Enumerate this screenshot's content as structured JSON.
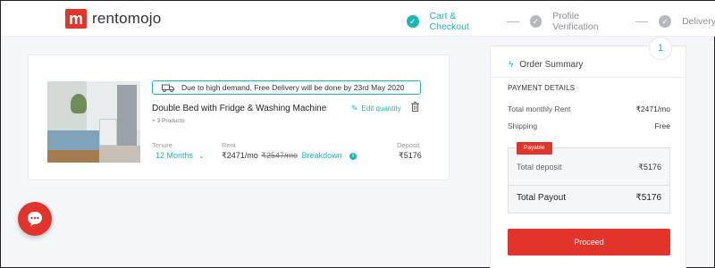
{
  "brand": {
    "logo_letter": "m",
    "name": "rentomojo",
    "color": "#e2342b"
  },
  "steps": [
    {
      "label": "Cart & Checkout",
      "state": "active",
      "icon": "check-icon"
    },
    {
      "label": "Profile Verification",
      "state": "pending",
      "icon": "check-icon"
    },
    {
      "label": "Delivery",
      "state": "pending",
      "icon": "check-icon"
    }
  ],
  "cart": {
    "delivery_note": "Due to high demand, Free Delivery will be done by 23rd May 2020",
    "product_title": "Double Bed with Fridge & Washing Machine",
    "product_sub": "+ 3 Products",
    "edit_label": "Edit quantity",
    "tenure_label": "Tenure",
    "tenure_value": "12 Months",
    "rent_label": "Rent",
    "rent_value": "₹2471/mo",
    "rent_old": "₹2547/mo",
    "breakdown_label": "Breakdown",
    "deposit_label": "Deposit",
    "deposit_value": "₹5176"
  },
  "summary": {
    "badge_count": "1",
    "title": "Order Summary",
    "section": "PAYMENT DETAILS",
    "rows": [
      {
        "label": "Total monthly Rent",
        "value": "₹2471/mo"
      },
      {
        "label": "Shipping",
        "value": "Free"
      }
    ],
    "payable_tag": "Payable",
    "deposit_label": "Total deposit",
    "deposit_value": "₹5176",
    "total_label": "Total Payout",
    "total_value": "₹5176",
    "proceed_label": "Proceed"
  },
  "colors": {
    "accent": "#1db5b5",
    "primary": "#e2342b"
  }
}
